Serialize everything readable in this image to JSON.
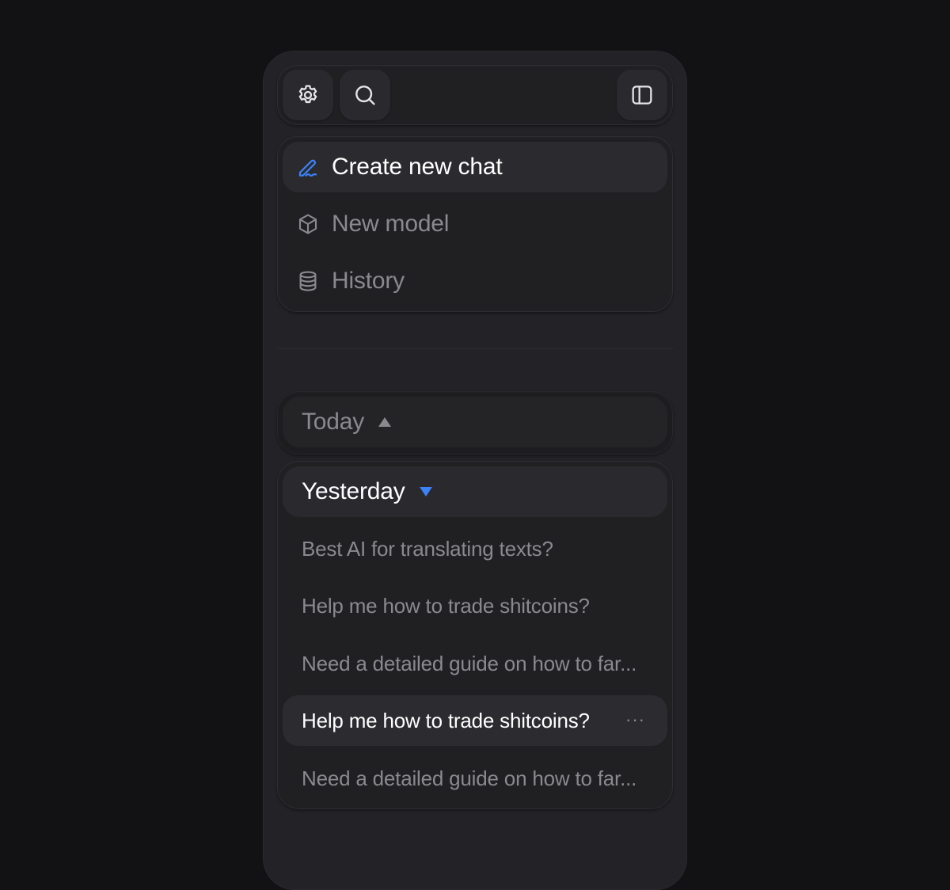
{
  "colors": {
    "background": "#121113",
    "panel": "#232226",
    "accent": "#3b82f6",
    "text_primary": "#ffffff",
    "text_muted": "#8a898e"
  },
  "toolbar": {
    "settings_icon": "gear-icon",
    "search_icon": "search-icon",
    "sidebar_toggle_icon": "sidebar-panel-icon"
  },
  "menu": {
    "items": [
      {
        "label": "Create new chat",
        "icon": "pen-signature-icon",
        "active": true
      },
      {
        "label": "New model",
        "icon": "cube-icon",
        "active": false
      },
      {
        "label": "History",
        "icon": "database-icon",
        "active": false
      }
    ]
  },
  "sections": {
    "today": {
      "label": "Today",
      "expanded": false
    },
    "yesterday": {
      "label": "Yesterday",
      "expanded": true,
      "chats": [
        {
          "label": "Best AI for translating texts?"
        },
        {
          "label": "Help me how to trade shitcoins?"
        },
        {
          "label": "Need a detailed guide on how to far..."
        },
        {
          "label": "Help me how to trade shitcoins?",
          "more": "···"
        },
        {
          "label": "Need a detailed guide on how to far..."
        }
      ]
    }
  }
}
